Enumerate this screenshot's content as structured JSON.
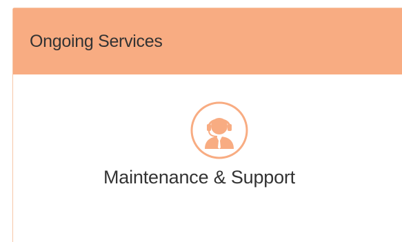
{
  "panel": {
    "title": "Ongoing Services",
    "header_color": "#f8ac82",
    "border_color": "#f6c6a6"
  },
  "services": [
    {
      "label": "Maintenance & Support",
      "icon": "customer-support-headset-icon",
      "icon_color": "#f8ac82"
    }
  ]
}
